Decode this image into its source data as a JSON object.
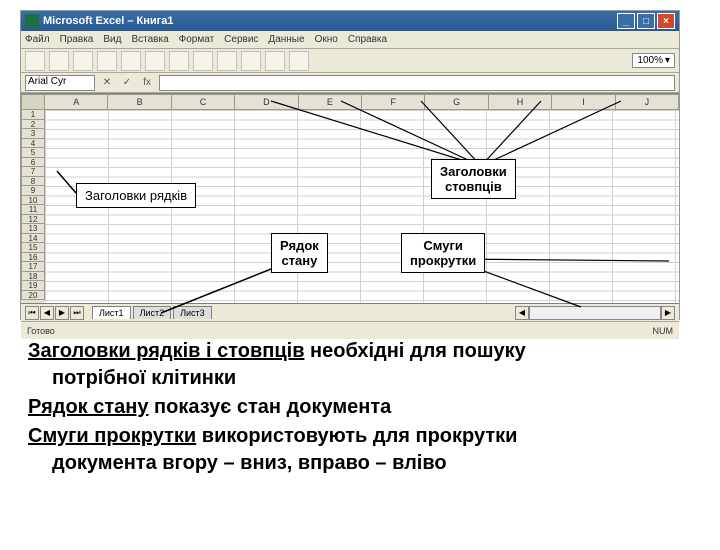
{
  "titlebar": {
    "app": "Microsoft Excel",
    "doc": "Книга1",
    "full": "Microsoft Excel – Книга1",
    "min": "_",
    "max": "□",
    "close": "×"
  },
  "menu": {
    "file": "Файл",
    "edit": "Правка",
    "view": "Вид",
    "insert": "Вставка",
    "format": "Формат",
    "tools": "Сервис",
    "data": "Данные",
    "window": "Окно",
    "help": "Справка"
  },
  "toolbar": {
    "zoom": "100%"
  },
  "formulabar": {
    "namebox": "Arial Cyr",
    "cancel": "✕",
    "confirm": "✓",
    "fx": "fx"
  },
  "columns": [
    "A",
    "B",
    "C",
    "D",
    "E",
    "F",
    "G",
    "H",
    "I",
    "J"
  ],
  "rows": [
    "1",
    "2",
    "3",
    "4",
    "5",
    "6",
    "7",
    "8",
    "9",
    "10",
    "11",
    "12",
    "13",
    "14",
    "15",
    "16",
    "17",
    "18",
    "19",
    "20"
  ],
  "sheets": {
    "s1": "Лист1",
    "s2": "Лист2",
    "s3": "Лист3",
    "nav_first": "⏮",
    "nav_prev": "◀",
    "nav_next": "▶",
    "nav_last": "⏭",
    "arrow_l": "◀",
    "arrow_r": "▶"
  },
  "statusbar": {
    "left": "Готово",
    "right": "NUM"
  },
  "annot": {
    "row_headers": "Заголовки рядків",
    "col_headers_l1": "Заголовки",
    "col_headers_l2": "стовпців",
    "status_row_l1": "Рядок",
    "status_row_l2": "стану",
    "scrollbars_l1": "Смуги",
    "scrollbars_l2": "прокрутки"
  },
  "bodytext": {
    "p1_a": "Заголовки рядків і стовпців",
    "p1_b": " необхідні для пошуку",
    "p1_c": "потрібної клітинки",
    "p2_a": "Рядок стану",
    "p2_b": " показує стан документа",
    "p3_a": "Смуги прокрутки",
    "p3_b": " використовують для прокрутки",
    "p3_c": "документа вгору – вниз, вправо – вліво"
  }
}
